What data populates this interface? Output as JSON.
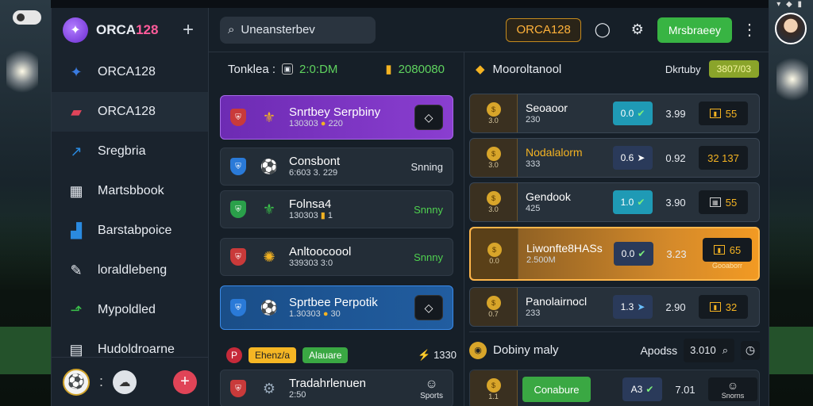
{
  "app": {
    "brand": "ORCA",
    "brand_num": "128"
  },
  "sidebar": {
    "items": [
      {
        "label": "ORCA128",
        "icon": "star-icon"
      },
      {
        "label": "ORCA128",
        "icon": "chart-icon"
      },
      {
        "label": "Sregbria",
        "icon": "trend-icon"
      },
      {
        "label": "Martsbbook",
        "icon": "grid-icon"
      },
      {
        "label": "Barstabpoice",
        "icon": "bar-icon"
      },
      {
        "label": "loraldlebeng",
        "icon": "edit-icon"
      },
      {
        "label": "Mypoldled",
        "icon": "arrow-icon"
      },
      {
        "label": "Hudoldroarne",
        "icon": "table-icon"
      }
    ],
    "footer_dots": ":"
  },
  "header": {
    "search_placeholder": "Uneansterbev",
    "brand_pill": "ORCA128",
    "cta": "Mrsbraeey"
  },
  "matches_panel": {
    "head_label": "Tonklea :",
    "head_time": "2:0:DM",
    "head_count": "2080080",
    "items": [
      {
        "title": "Snrtbey Serpbiny",
        "sub1": "130303",
        "sub2": "220",
        "right": ""
      },
      {
        "title": "Consbont",
        "sub1": "6:603",
        "sub2": "3. 229",
        "right": "Snning"
      },
      {
        "title": "Folnsa4",
        "sub1": "130303",
        "sub2": "1",
        "right": "Snnny"
      },
      {
        "title": "Anltoocoool",
        "sub1": "339303",
        "sub2": "3:0",
        "right": "Snnny"
      },
      {
        "title": "Sprtbee Perpotik",
        "sub1": "1.30303",
        "sub2": "30",
        "right": ""
      },
      {
        "title": "Tradahrlenuen",
        "sub1": "",
        "sub2": "2:50",
        "right": "Sports"
      }
    ],
    "filter_chip1": "Ehenz/a",
    "filter_chip2": "Alauare",
    "filter_count": "1330"
  },
  "odds_panel": {
    "head_title": "Mooroltanool",
    "head_label": "Dkrtuby",
    "head_badge": "3807/03",
    "rows": [
      {
        "tag": "3.0",
        "name": "Seoaoor",
        "sub": "230",
        "odd_btn": "0.0",
        "odd": "3.99",
        "val": "55"
      },
      {
        "tag": "3.0",
        "name": "Nodalalorm",
        "sub": "333",
        "odd_btn": "0.6",
        "odd": "0.92",
        "val": "32 137"
      },
      {
        "tag": "3.0",
        "name": "Gendook",
        "sub": "425",
        "odd_btn": "1.0",
        "odd": "3.90",
        "val": "55"
      },
      {
        "tag": "0.0",
        "name": "Liwonfte8HASs",
        "sub": "2.500M",
        "odd_btn": "0.0",
        "odd": "3.23",
        "val": "65",
        "val_sub": "Gooaborr"
      },
      {
        "tag": "0.7",
        "name": "Panolairnocl",
        "sub": "233",
        "odd_btn": "1.3",
        "odd": "2.90",
        "val": "32"
      }
    ],
    "sub_title": "Dobiny maly",
    "sub_label": "Apodss",
    "sub_value": "3.010",
    "last_row": {
      "tag": "1.1",
      "button": "Conabure",
      "odd_btn": "A3",
      "odd": "7.01",
      "val": "Snorns"
    }
  }
}
